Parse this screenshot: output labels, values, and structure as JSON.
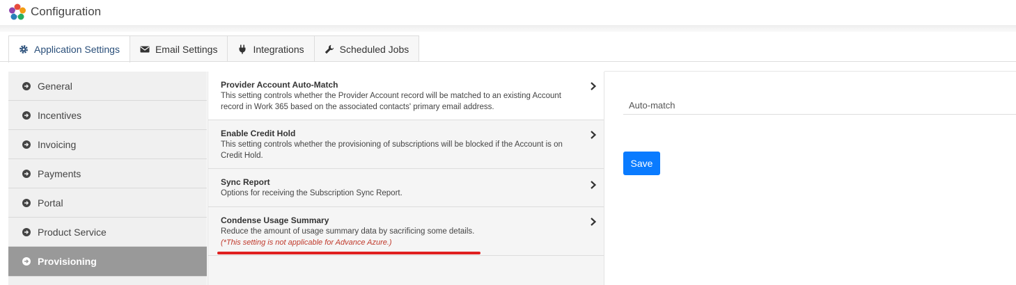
{
  "app": {
    "title": "Configuration"
  },
  "tabs": [
    {
      "label": "Application Settings",
      "icon": "gear-icon",
      "active": true
    },
    {
      "label": "Email Settings",
      "icon": "envelope-icon",
      "active": false
    },
    {
      "label": "Integrations",
      "icon": "plug-icon",
      "active": false
    },
    {
      "label": "Scheduled Jobs",
      "icon": "wrench-icon",
      "active": false
    }
  ],
  "sidebar": {
    "items": [
      {
        "label": "General"
      },
      {
        "label": "Incentives"
      },
      {
        "label": "Invoicing"
      },
      {
        "label": "Payments"
      },
      {
        "label": "Portal"
      },
      {
        "label": "Product Service"
      },
      {
        "label": "Provisioning",
        "active": true
      }
    ]
  },
  "settings": [
    {
      "title": "Provider Account Auto-Match",
      "description": "This setting controls whether the Provider Account record will be matched to an existing Account record in Work 365 based on the associated contacts' primary email address.",
      "note": ""
    },
    {
      "title": "Enable Credit Hold",
      "description": "This setting controls whether the provisioning of subscriptions will be blocked if the Account is on Credit Hold.",
      "note": ""
    },
    {
      "title": "Sync Report",
      "description": "Options for receiving the Subscription Sync Report.",
      "note": ""
    },
    {
      "title": "Condense Usage Summary",
      "description": "Reduce the amount of usage summary data by sacrificing some details.",
      "note": "(*This setting is not applicable for Advance Azure.)"
    }
  ],
  "detail": {
    "selected_value": "Auto-match",
    "save_label": "Save"
  },
  "colors": {
    "accent": "#0a7bff",
    "active_tab_text": "#2a4f7a",
    "sidebar_active": "#999999",
    "note_red": "#c0392b",
    "annotation_red": "#e02020"
  }
}
